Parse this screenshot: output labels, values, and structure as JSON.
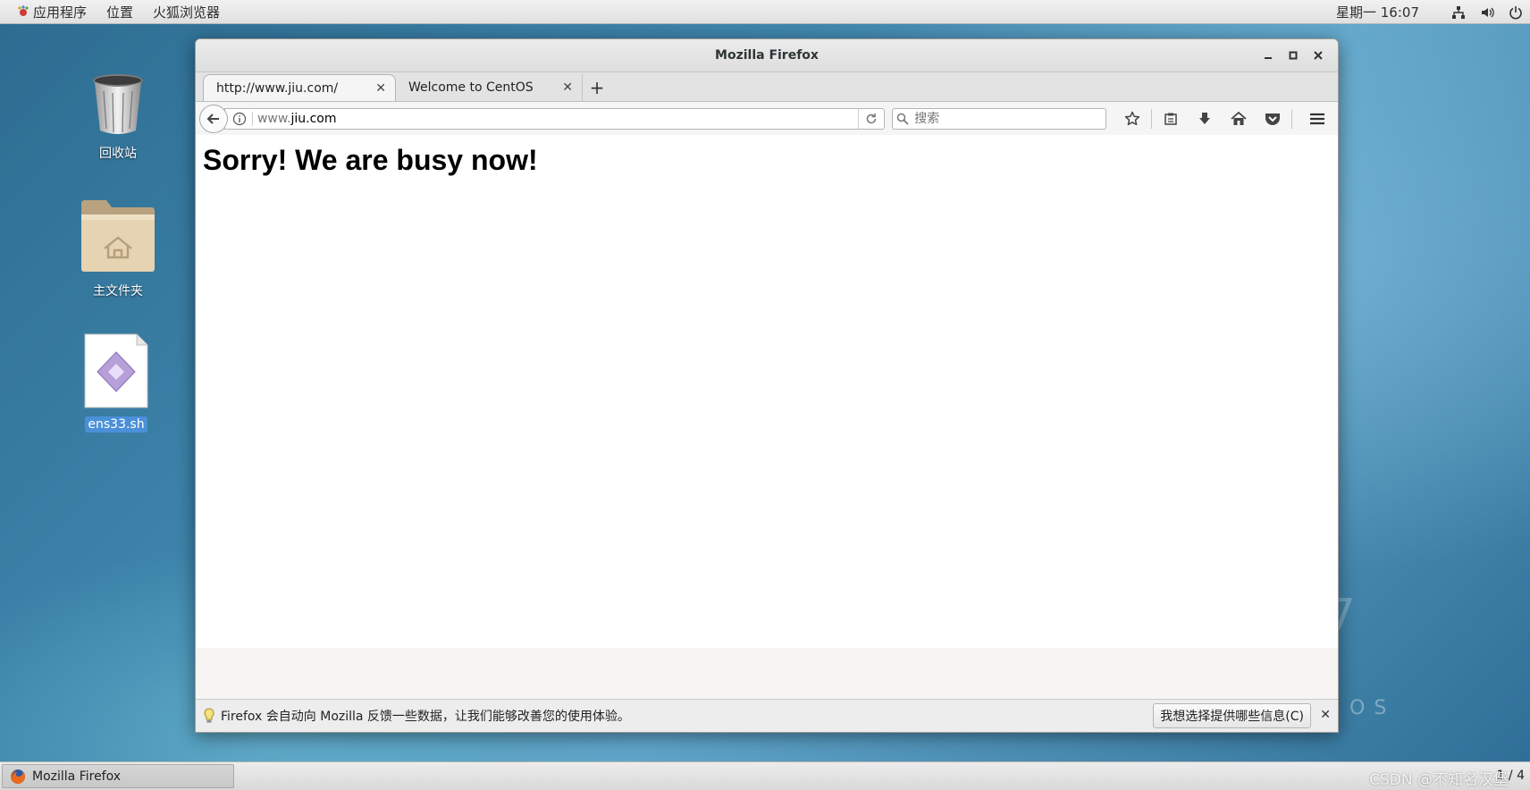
{
  "top_panel": {
    "applications": "应用程序",
    "places": "位置",
    "active_app": "火狐浏览器",
    "clock": "星期一 16:07"
  },
  "desktop": {
    "icons": [
      {
        "label": "回收站",
        "icon": "trash-icon"
      },
      {
        "label": "主文件夹",
        "icon": "home-folder-icon"
      },
      {
        "label": "ens33.sh",
        "icon": "script-file-icon",
        "selected": true
      }
    ],
    "wallpaper_text": {
      "version": "7",
      "os": "OS"
    }
  },
  "window": {
    "title": "Mozilla Firefox",
    "tabs": [
      {
        "label": "http://www.jiu.com/",
        "active": true
      },
      {
        "label": "Welcome to CentOS",
        "active": false
      }
    ],
    "url": {
      "prefix": "www.",
      "domain": "jiu.com"
    },
    "search_placeholder": "搜索",
    "page_heading": "Sorry! We are busy now!",
    "notification": {
      "message": "Firefox 会自动向 Mozilla 反馈一些数据，让我们能够改善您的使用体验。",
      "button_label": "我想选择提供哪些信息(C)"
    }
  },
  "taskbar": {
    "item_label": "Mozilla Firefox",
    "workspace": "1 / 4",
    "watermark": "CSDN @不知名汉堡"
  },
  "colors": {
    "selection": "#4a90d9",
    "panel_bg": "#e6e6e6",
    "wallpaper": "#3f86ad"
  }
}
